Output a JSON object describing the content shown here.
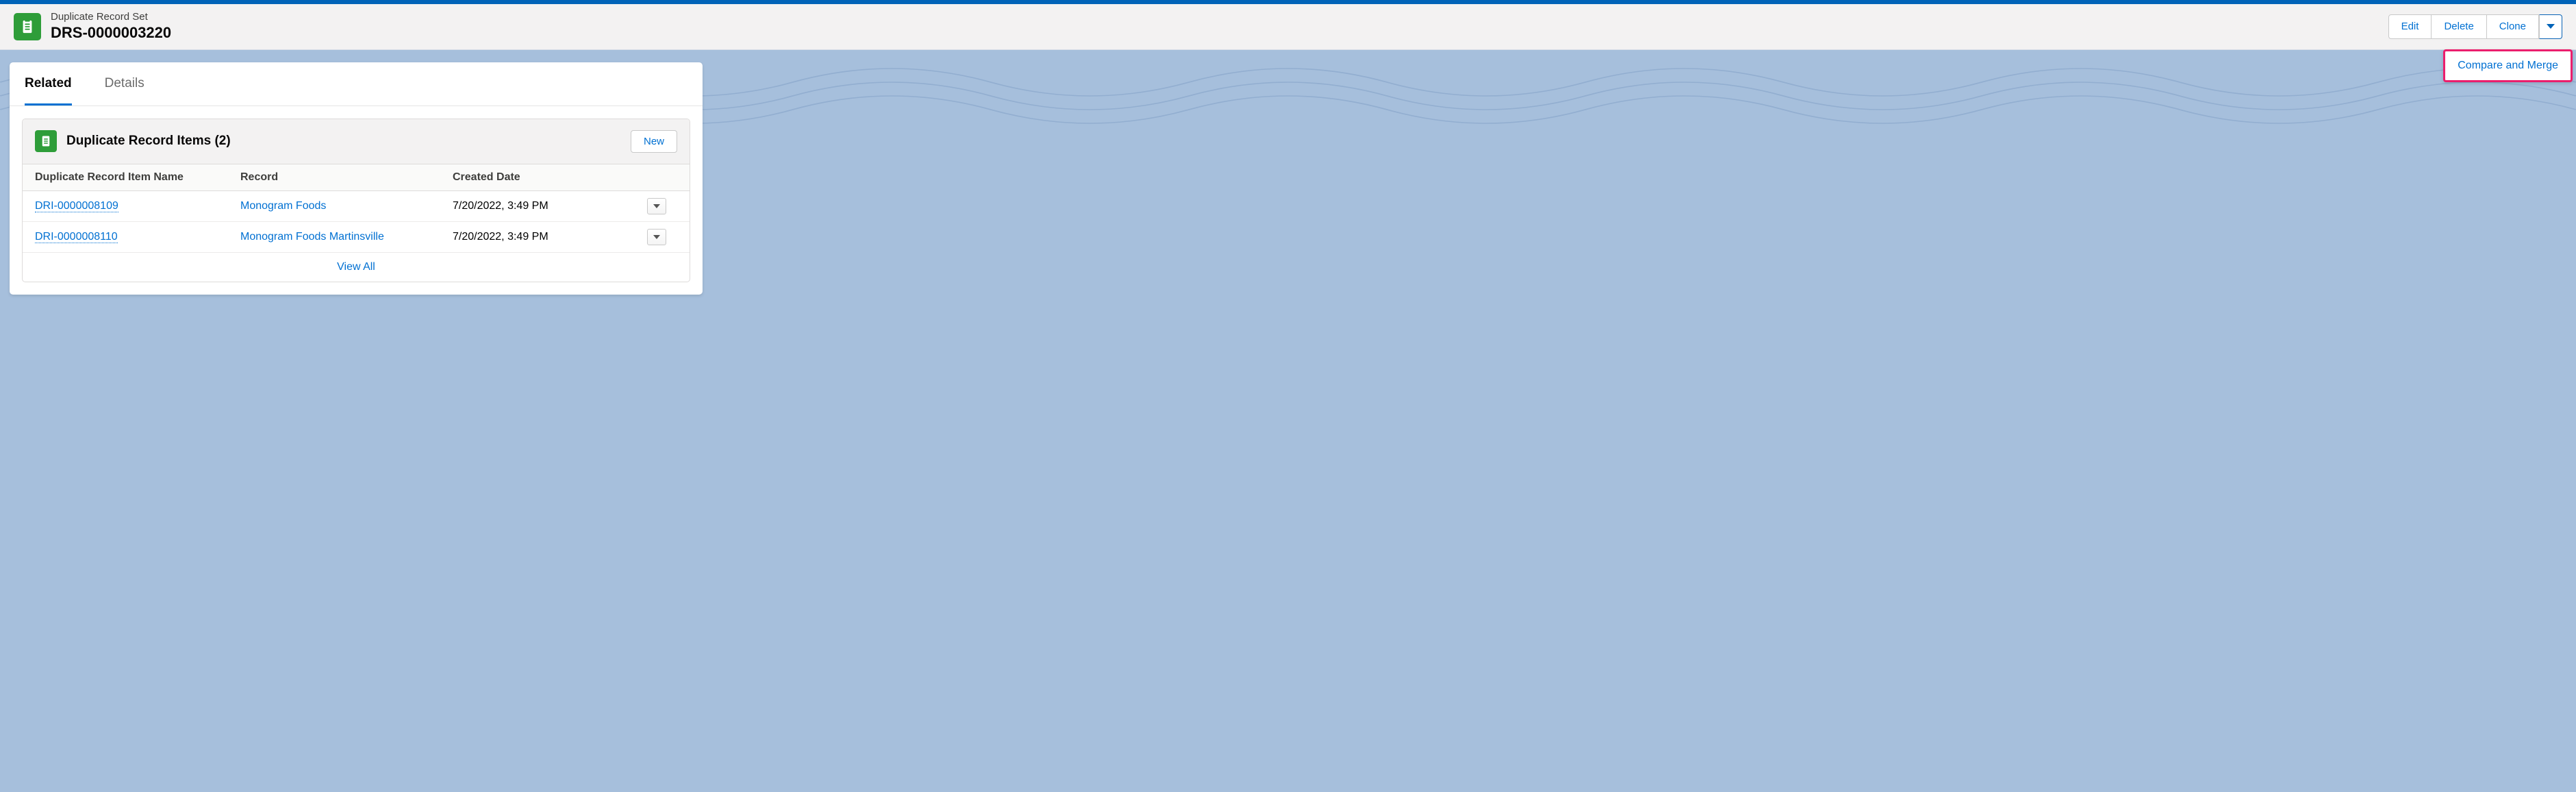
{
  "header": {
    "record_type": "Duplicate Record Set",
    "record_name": "DRS-0000003220",
    "buttons": {
      "edit": "Edit",
      "delete": "Delete",
      "clone": "Clone"
    },
    "dropdown": {
      "compare_merge": "Compare and Merge"
    }
  },
  "tabs": {
    "related": "Related",
    "details": "Details"
  },
  "related_list": {
    "title": "Duplicate Record Items (2)",
    "new_btn": "New",
    "columns": {
      "name": "Duplicate Record Item Name",
      "record": "Record",
      "created": "Created Date"
    },
    "rows": [
      {
        "name": "DRI-0000008109",
        "record": "Monogram Foods",
        "created": "7/20/2022, 3:49 PM"
      },
      {
        "name": "DRI-0000008110",
        "record": "Monogram Foods Martinsville",
        "created": "7/20/2022, 3:49 PM"
      }
    ],
    "view_all": "View All"
  }
}
